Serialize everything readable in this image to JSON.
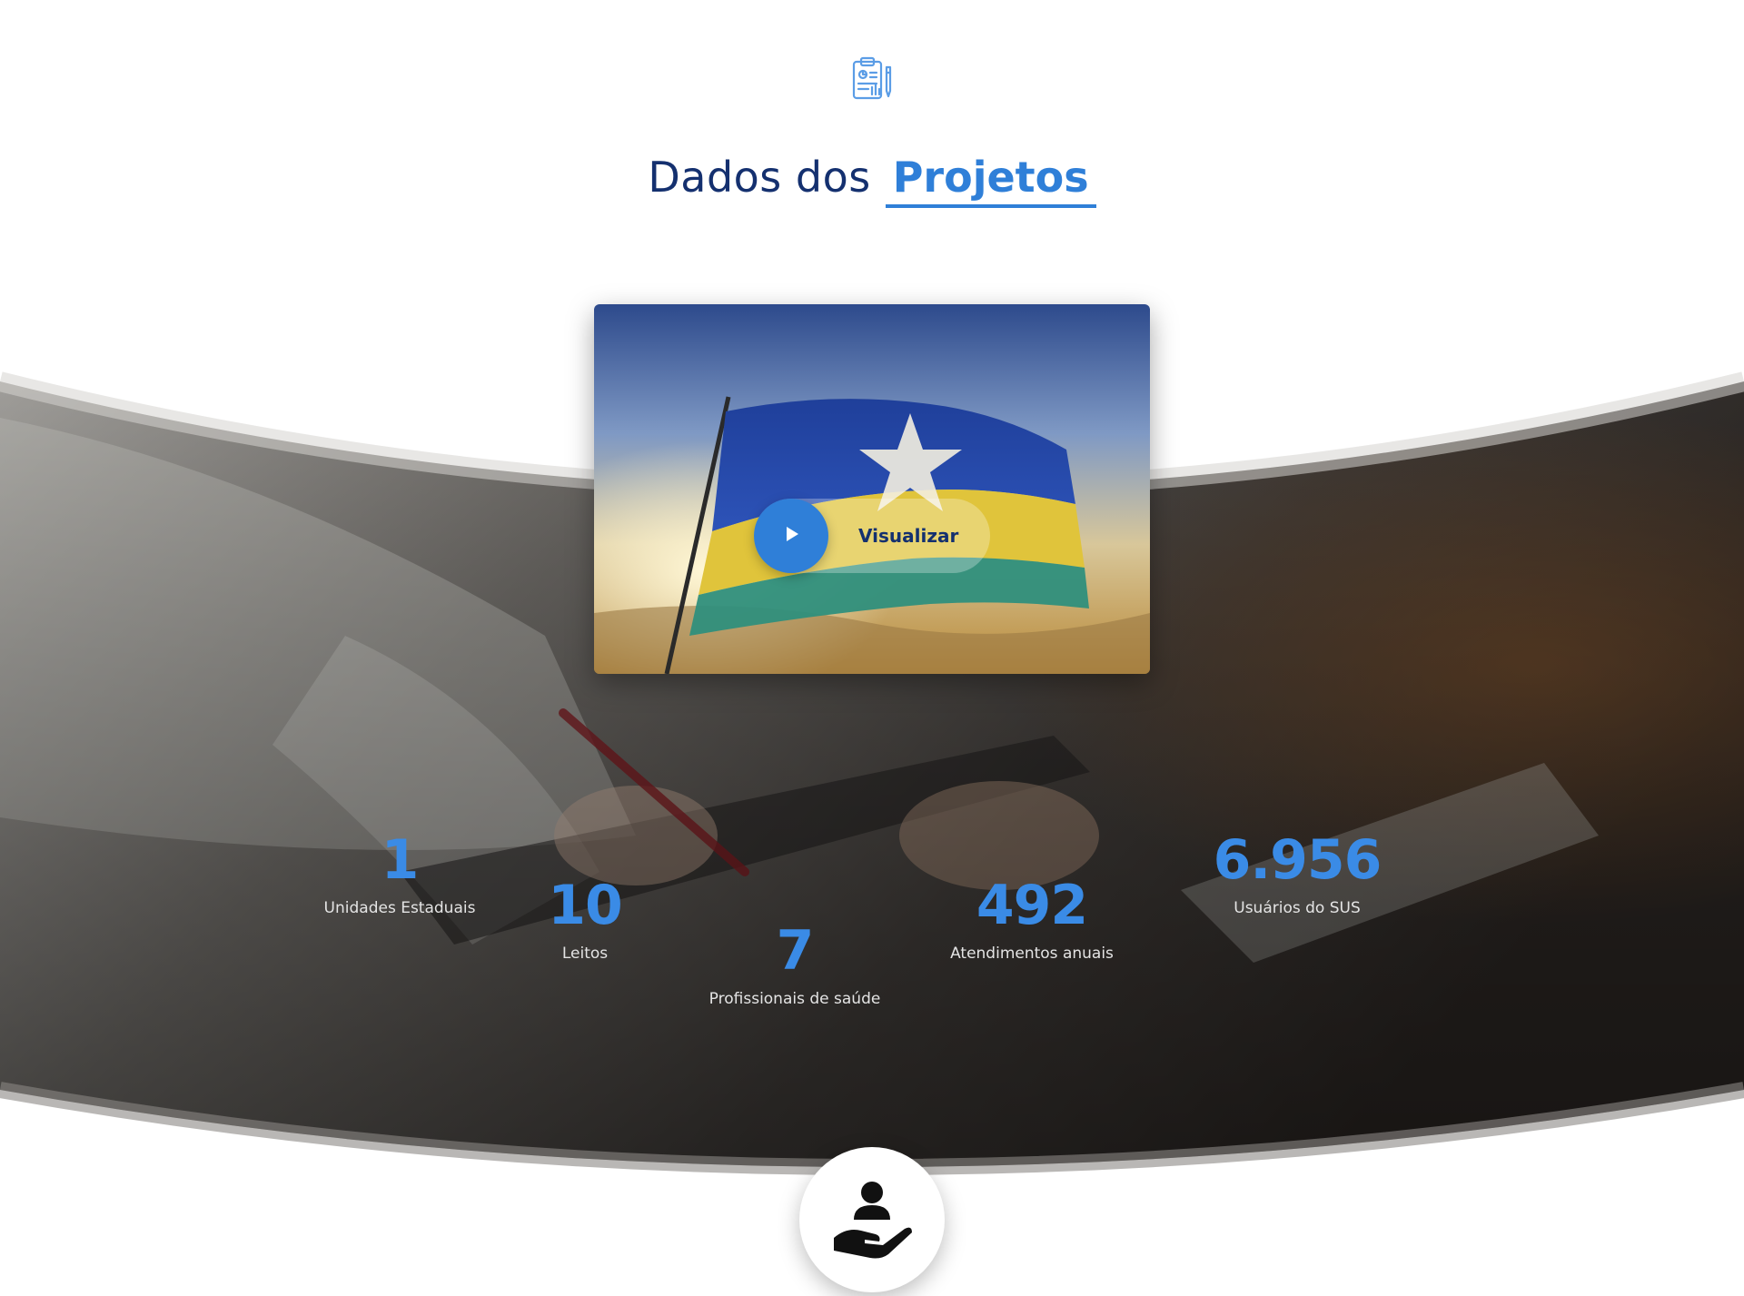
{
  "section": {
    "icon": "report-clipboard-icon",
    "title_plain": "Dados dos",
    "title_highlight": "Projetos"
  },
  "video": {
    "play_icon": "play-icon",
    "label": "Visualizar"
  },
  "stats": [
    {
      "value": "1",
      "label": "Unidades Estaduais"
    },
    {
      "value": "10",
      "label": "Leitos"
    },
    {
      "value": "7",
      "label": "Profissionais de saúde"
    },
    {
      "value": "492",
      "label": "Atendimentos anuais"
    },
    {
      "value": "6.956",
      "label": "Usuários do SUS"
    }
  ],
  "footer_icon": "person-in-hand-icon",
  "colors": {
    "accent": "#2f7fd8",
    "navy": "#14306f",
    "stat_number": "#3a8be6"
  }
}
